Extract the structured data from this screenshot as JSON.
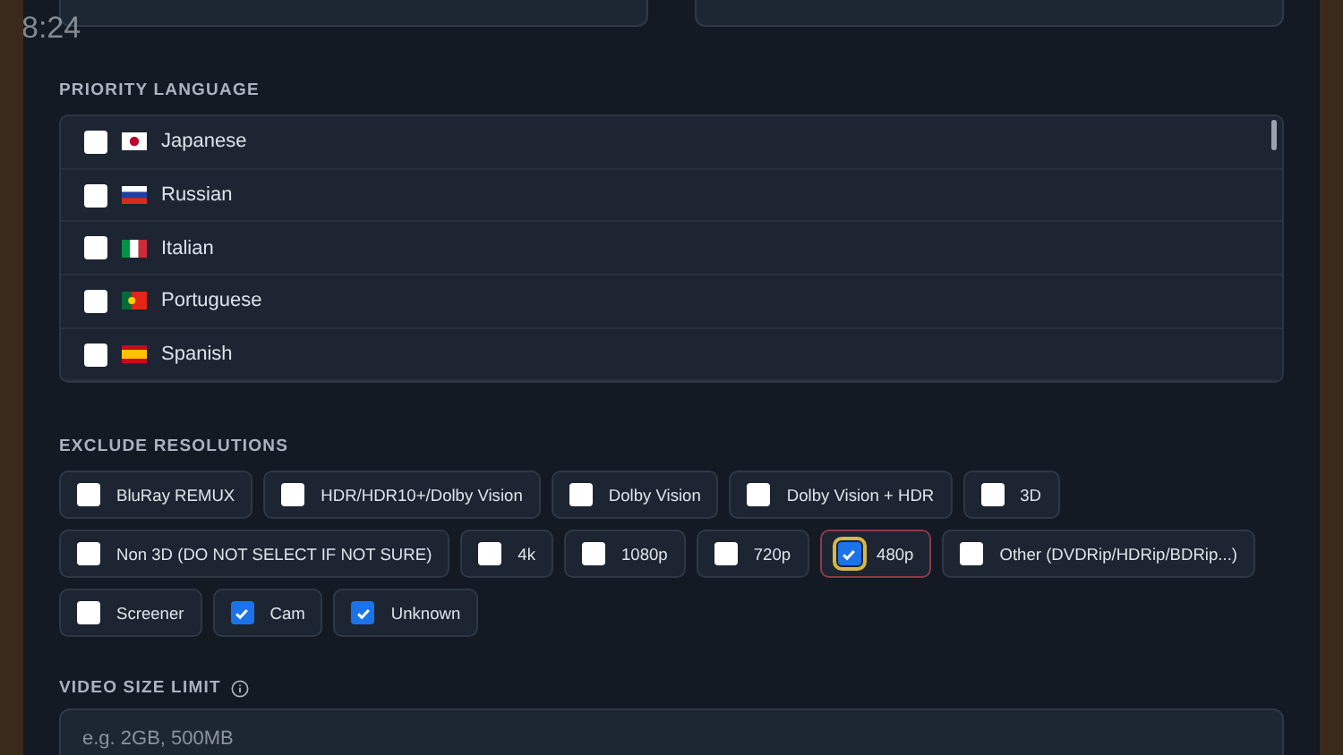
{
  "clock": "8:24",
  "priority_language": {
    "label": "PRIORITY LANGUAGE",
    "items": [
      {
        "name": "Japanese",
        "kind": "jp",
        "checked": false
      },
      {
        "name": "Russian",
        "kind": "ru",
        "checked": false
      },
      {
        "name": "Italian",
        "kind": "it",
        "checked": false
      },
      {
        "name": "Portuguese",
        "kind": "pt",
        "checked": false
      },
      {
        "name": "Spanish",
        "kind": "es",
        "checked": false
      }
    ]
  },
  "exclude_resolutions": {
    "label": "EXCLUDE RESOLUTIONS",
    "options": [
      {
        "label": "BluRay REMUX",
        "checked": false,
        "focused": false
      },
      {
        "label": "HDR/HDR10+/Dolby Vision",
        "checked": false,
        "focused": false
      },
      {
        "label": "Dolby Vision",
        "checked": false,
        "focused": false
      },
      {
        "label": "Dolby Vision + HDR",
        "checked": false,
        "focused": false
      },
      {
        "label": "3D",
        "checked": false,
        "focused": false
      },
      {
        "label": "Non 3D (DO NOT SELECT IF NOT SURE)",
        "checked": false,
        "focused": false
      },
      {
        "label": "4k",
        "checked": false,
        "focused": false
      },
      {
        "label": "1080p",
        "checked": false,
        "focused": false
      },
      {
        "label": "720p",
        "checked": false,
        "focused": false
      },
      {
        "label": "480p",
        "checked": true,
        "focused": true
      },
      {
        "label": "Other (DVDRip/HDRip/BDRip...)",
        "checked": false,
        "focused": false
      },
      {
        "label": "Screener",
        "checked": false,
        "focused": false
      },
      {
        "label": "Cam",
        "checked": true,
        "focused": false
      },
      {
        "label": "Unknown",
        "checked": true,
        "focused": false
      }
    ]
  },
  "video_size_limit": {
    "label": "VIDEO SIZE LIMIT",
    "placeholder": "e.g. 2GB, 500MB"
  }
}
